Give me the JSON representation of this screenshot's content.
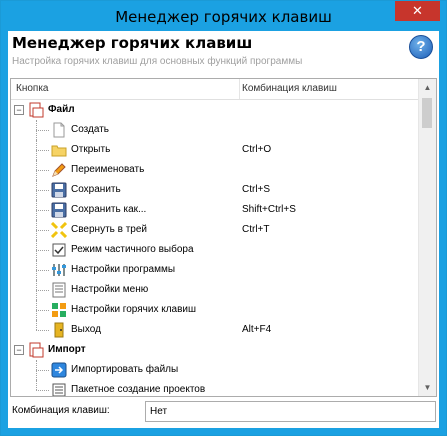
{
  "window": {
    "title": "Менеджер горячих клавиш",
    "close_glyph": "✕"
  },
  "header": {
    "title": "Менеджер горячих клавиш",
    "subtitle": "Настройка горячих клавиш для основных функций программы",
    "help_glyph": "?"
  },
  "columns": {
    "button": "Кнопка",
    "shortcut": "Комбинация клавиш"
  },
  "tree": [
    {
      "type": "category",
      "label": "Файл",
      "icon": "file-category-icon",
      "expander": "−"
    },
    {
      "type": "item",
      "label": "Создать",
      "shortcut": "",
      "icon": "new-document-icon"
    },
    {
      "type": "item",
      "label": "Открыть",
      "shortcut": "Ctrl+O",
      "icon": "open-folder-icon"
    },
    {
      "type": "item",
      "label": "Переименовать",
      "shortcut": "",
      "icon": "rename-pencil-icon"
    },
    {
      "type": "item",
      "label": "Сохранить",
      "shortcut": "Ctrl+S",
      "icon": "save-disk-icon"
    },
    {
      "type": "item",
      "label": "Сохранить как...",
      "shortcut": "Shift+Ctrl+S",
      "icon": "save-as-disk-icon"
    },
    {
      "type": "item",
      "label": "Свернуть в трей",
      "shortcut": "Ctrl+T",
      "icon": "minimize-to-tray-icon"
    },
    {
      "type": "item",
      "label": "Режим частичного выбора",
      "shortcut": "",
      "icon": "partial-select-icon"
    },
    {
      "type": "item",
      "label": "Настройки программы",
      "shortcut": "",
      "icon": "program-settings-icon"
    },
    {
      "type": "item",
      "label": "Настройки меню",
      "shortcut": "",
      "icon": "menu-settings-icon"
    },
    {
      "type": "item",
      "label": "Настройки горячих клавиш",
      "shortcut": "",
      "icon": "hotkey-settings-icon"
    },
    {
      "type": "item",
      "label": "Выход",
      "shortcut": "Alt+F4",
      "icon": "exit-door-icon"
    },
    {
      "type": "category",
      "label": "Импорт",
      "icon": "import-category-icon",
      "expander": "−"
    },
    {
      "type": "item",
      "label": "Импортировать файлы",
      "shortcut": "",
      "icon": "import-files-icon"
    },
    {
      "type": "item",
      "label": "Пакетное создание проектов",
      "shortcut": "",
      "icon": "batch-projects-icon"
    }
  ],
  "footer": {
    "label": "Комбинация клавиш:",
    "value": "Нет"
  },
  "scrollbar": {
    "up_glyph": "▲",
    "down_glyph": "▼"
  },
  "colors": {
    "titlebar": "#1ba1e2",
    "close": "#c7352c",
    "subtitle": "#a0a0a0"
  }
}
